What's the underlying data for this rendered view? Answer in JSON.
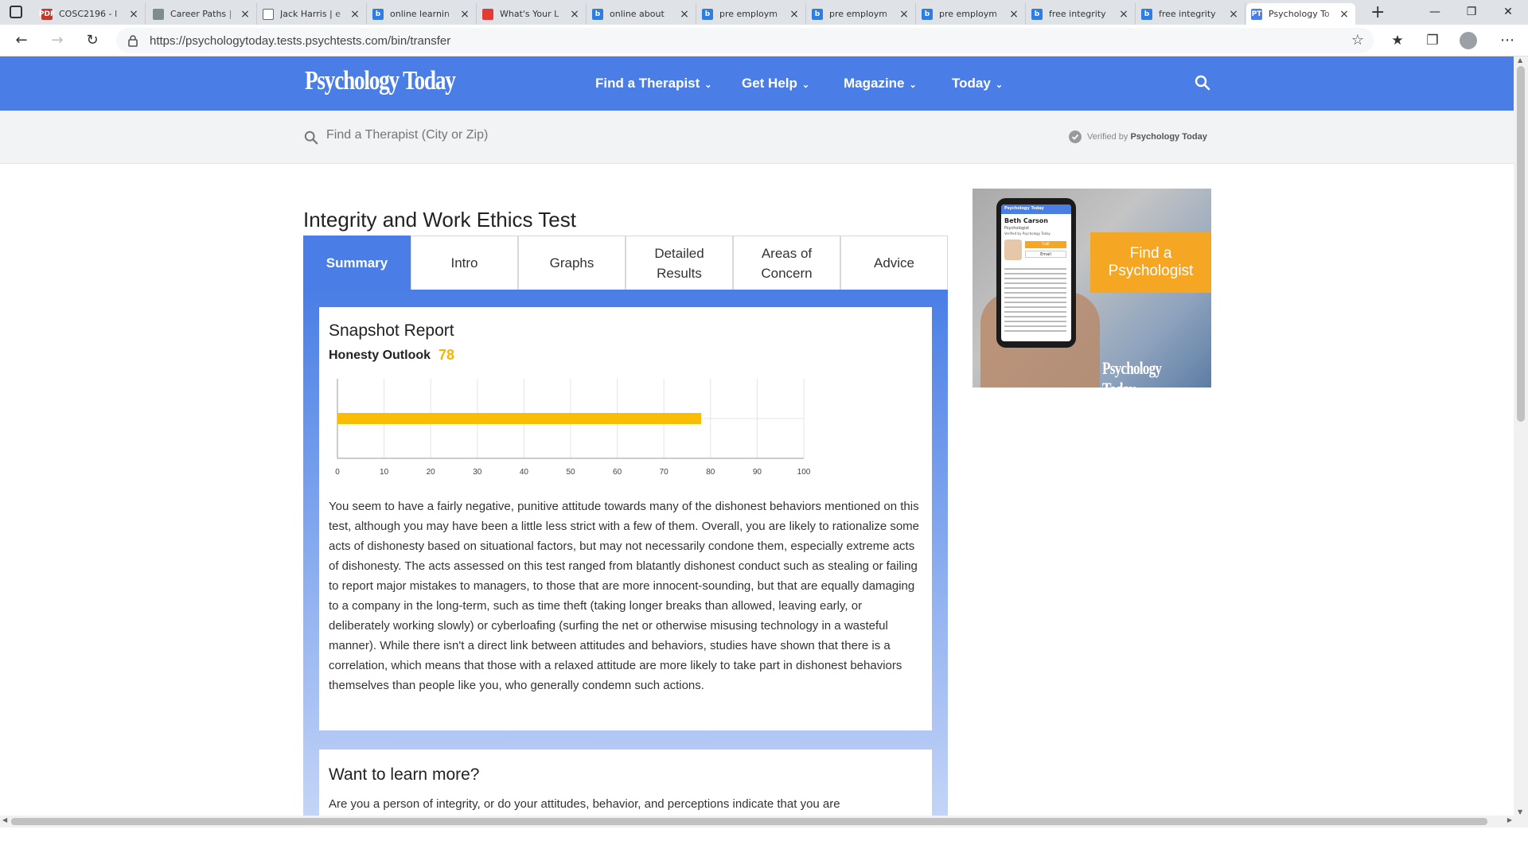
{
  "browser": {
    "tabs": [
      {
        "title": "COSC2196 - I",
        "favicon_color": "#c0392b",
        "favicon_text": "PDF"
      },
      {
        "title": "Career Paths |",
        "favicon_color": "#7f8c8d",
        "favicon_text": ""
      },
      {
        "title": "Jack Harris | e",
        "favicon_color": "#ffffff",
        "favicon_text": ""
      },
      {
        "title": "online learnin",
        "favicon_color": "#2f7de1",
        "favicon_text": "b"
      },
      {
        "title": "What's Your L",
        "favicon_color": "#e53935",
        "favicon_text": ""
      },
      {
        "title": "online about",
        "favicon_color": "#2f7de1",
        "favicon_text": "b"
      },
      {
        "title": "pre employm",
        "favicon_color": "#2f7de1",
        "favicon_text": "b"
      },
      {
        "title": "pre employm",
        "favicon_color": "#2f7de1",
        "favicon_text": "b"
      },
      {
        "title": "pre employm",
        "favicon_color": "#2f7de1",
        "favicon_text": "b"
      },
      {
        "title": "free integrity",
        "favicon_color": "#2f7de1",
        "favicon_text": "b"
      },
      {
        "title": "free integrity",
        "favicon_color": "#2f7de1",
        "favicon_text": "b"
      },
      {
        "title": "Psychology To",
        "favicon_color": "#4a7ee6",
        "favicon_text": "PT"
      }
    ],
    "url": "https://psychologytoday.tests.psychtests.com/bin/transfer"
  },
  "site": {
    "logo": "Psychology Today",
    "nav": [
      "Find a Therapist",
      "Get Help",
      "Magazine",
      "Today"
    ],
    "search_placeholder": "Find a Therapist (City or Zip)",
    "verified_prefix": "Verified by",
    "verified_brand": "Psychology Today"
  },
  "page": {
    "title": "Integrity and Work Ethics Test",
    "tabs": [
      {
        "label": "Summary",
        "active": true
      },
      {
        "label": "Intro",
        "active": false
      },
      {
        "label": "Graphs",
        "active": false
      },
      {
        "label": "Detailed Results",
        "active": false
      },
      {
        "label": "Areas of Concern",
        "active": false
      },
      {
        "label": "Advice",
        "active": false
      }
    ],
    "report": {
      "heading": "Snapshot Report",
      "score_label": "Honesty Outlook",
      "score_value": "78",
      "body": "You seem to have a fairly negative, punitive attitude towards many of the dishonest behaviors mentioned on this test, although you may have been a little less strict with a few of them. Overall, you are likely to rationalize some acts of dishonesty based on situational factors, but may not necessarily condone them, especially extreme acts of dishonesty. The acts assessed on this test ranged from blatantly dishonest conduct such as stealing or failing to report major mistakes to managers, to those that are more innocent-sounding, but that are equally damaging to a company in the long-term, such as time theft (taking longer breaks than allowed, leaving early, or deliberately working slowly) or cyberloafing (surfing the net or otherwise misusing technology in a wasteful manner). While there isn't a direct link between attitudes and behaviors, studies have shown that there is a correlation, which means that those with a relaxed attitude are more likely to take part in dishonest behaviors themselves than people like you, who generally condemn such actions."
    },
    "learn_more": {
      "heading": "Want to learn more?",
      "body": "Are you a person of integrity, or do your attitudes, behavior, and perceptions indicate that you are"
    }
  },
  "ad": {
    "cta": "Find a Psychologist",
    "logo": "Psychology Today",
    "phone_logo": "Psychology Today",
    "phone_name": "Beth Carson",
    "phone_role": "Psychologist",
    "phone_verified": "Verified by Psychology Today",
    "phone_call": "Call",
    "phone_email": "Email"
  },
  "chart_data": {
    "type": "bar",
    "orientation": "horizontal",
    "categories": [
      ""
    ],
    "values": [
      78
    ],
    "xlim": [
      0,
      100
    ],
    "xticks": [
      0,
      10,
      20,
      30,
      40,
      50,
      60,
      70,
      80,
      90,
      100
    ],
    "grid": true,
    "bar_color": "#fbbc05"
  },
  "colors": {
    "brand_blue": "#4a7ee6",
    "score_color": "#f2b705",
    "cta_orange": "#f5a623"
  }
}
